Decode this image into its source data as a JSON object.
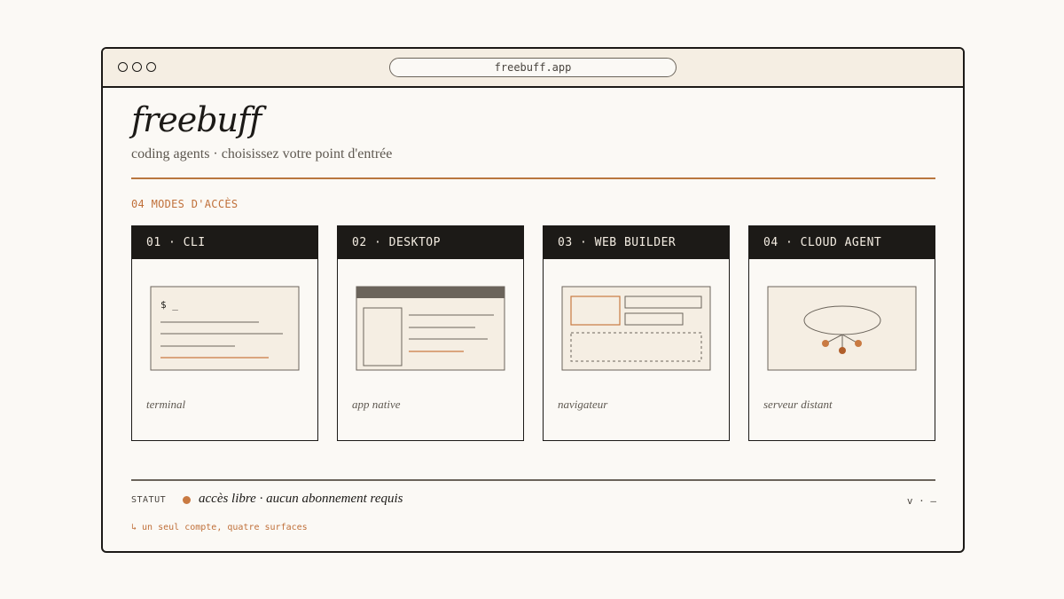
{
  "browser": {
    "url": "freebuff.app"
  },
  "header": {
    "brand": "freebuff",
    "tagline": "coding agents · choisissez votre point d'entrée"
  },
  "section": {
    "label": "04 MODES D'ACCÈS"
  },
  "cards": [
    {
      "title": "01 · CLI",
      "caption": "terminal",
      "prompt": "$ _"
    },
    {
      "title": "02 · DESKTOP",
      "caption": "app native"
    },
    {
      "title": "03 · WEB BUILDER",
      "caption": "navigateur"
    },
    {
      "title": "04 · CLOUD AGENT",
      "caption": "serveur distant"
    }
  ],
  "status": {
    "label": "STATUT",
    "text": "accès libre · aucun abonnement requis",
    "right": "v · —"
  },
  "footnote": "↳ un seul compte, quatre surfaces",
  "colors": {
    "accent": "#c97a42",
    "ink": "#1c1a17",
    "paper": "#fbf9f5",
    "panel": "#f5eee3"
  }
}
